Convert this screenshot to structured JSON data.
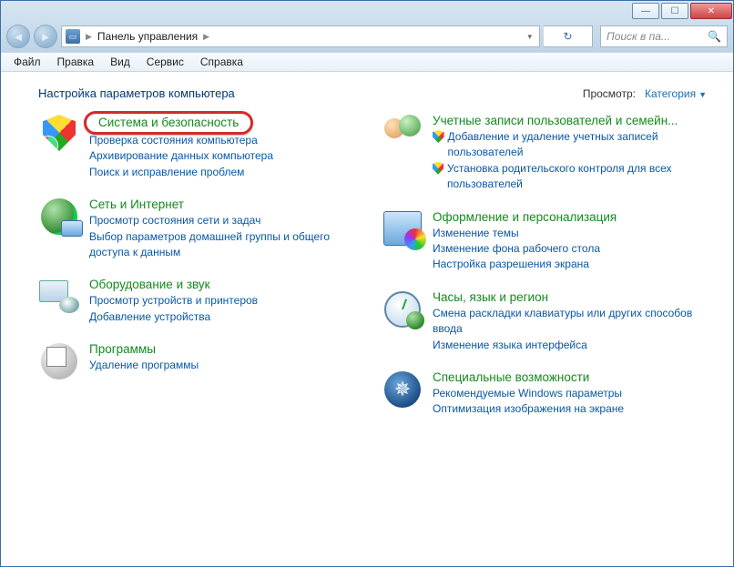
{
  "window": {
    "breadcrumb": "Панель управления",
    "search_placeholder": "Поиск в па..."
  },
  "menu": {
    "file": "Файл",
    "edit": "Правка",
    "view": "Вид",
    "tools": "Сервис",
    "help": "Справка"
  },
  "header": {
    "title": "Настройка параметров компьютера",
    "view_label": "Просмотр:",
    "view_value": "Категория"
  },
  "left": [
    {
      "title": "Система и безопасность",
      "subs": [
        "Проверка состояния компьютера",
        "Архивирование данных компьютера",
        "Поиск и исправление проблем"
      ]
    },
    {
      "title": "Сеть и Интернет",
      "subs": [
        "Просмотр состояния сети и задач",
        "Выбор параметров домашней группы и общего доступа к данным"
      ]
    },
    {
      "title": "Оборудование и звук",
      "subs": [
        "Просмотр устройств и принтеров",
        "Добавление устройства"
      ]
    },
    {
      "title": "Программы",
      "subs": [
        "Удаление программы"
      ]
    }
  ],
  "right": [
    {
      "title": "Учетные записи пользователей и семейн...",
      "shielded": [
        "Добавление и удаление учетных записей пользователей",
        "Установка родительского контроля для всех пользователей"
      ]
    },
    {
      "title": "Оформление и персонализация",
      "subs": [
        "Изменение темы",
        "Изменение фона рабочего стола",
        "Настройка разрешения экрана"
      ]
    },
    {
      "title": "Часы, язык и регион",
      "subs": [
        "Смена раскладки клавиатуры или других способов ввода",
        "Изменение языка интерфейса"
      ]
    },
    {
      "title": "Специальные возможности",
      "subs": [
        "Рекомендуемые Windows параметры",
        "Оптимизация изображения на экране"
      ]
    }
  ]
}
